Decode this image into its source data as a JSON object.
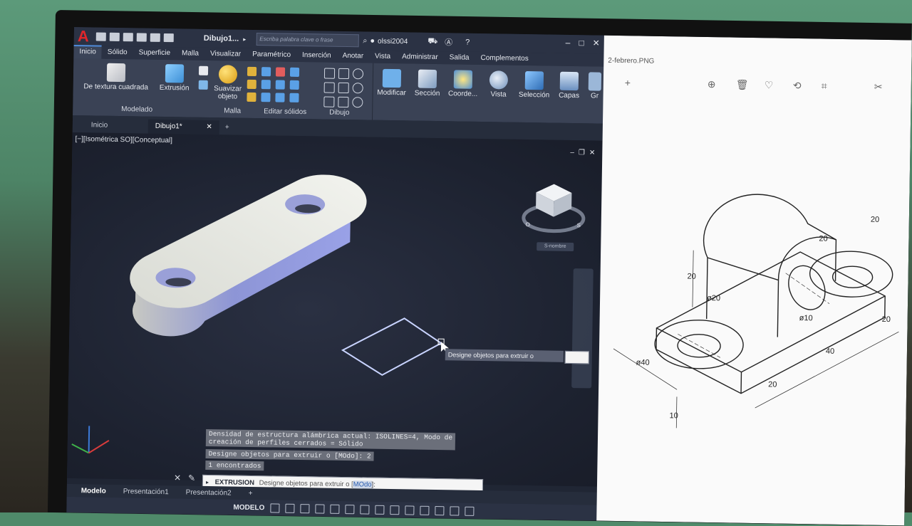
{
  "app": {
    "doc_title": "Dibujo1...",
    "search_placeholder": "Escriba palabra clave o frase",
    "user": "olssi2004"
  },
  "ribbon_tabs": [
    "Inicio",
    "Sólido",
    "Superficie",
    "Malla",
    "Visualizar",
    "Paramétrico",
    "Inserción",
    "Anotar",
    "Vista",
    "Administrar",
    "Salida",
    "Complementos"
  ],
  "ribbon": {
    "textura": "De textura cuadrada",
    "extrusion": "Extrusión",
    "suavizar": "Suavizar\nobjeto",
    "modificar": "Modificar",
    "seccion": "Sección",
    "coorde": "Coorde...",
    "vista": "Vista",
    "seleccion": "Selección",
    "capas": "Capas",
    "gr": "Gr",
    "panel_modelado": "Modelado",
    "panel_malla": "Malla",
    "panel_editar": "Editar sólidos",
    "panel_dibujo": "Dibujo"
  },
  "file_tabs": {
    "start": "Inicio",
    "doc": "Dibujo1*"
  },
  "viewport": {
    "label": "[−][Isométrica SO][Conceptual]",
    "viewcube_label": "S-nombre"
  },
  "tooltip": "Designe objetos para extruir o",
  "command_history": [
    "Densidad de estructura alámbrica actual: ISOLINES=4, Modo de\ncreación de perfiles cerrados = Sólido",
    "Designe objetos para extruir o [MOdo]: 2",
    "1 encontrados"
  ],
  "command_line": {
    "command": "EXTRUSION",
    "prompt": "Designe objetos para extruir o [",
    "option": "MOdo",
    "suffix": "]:"
  },
  "layout_tabs": [
    "Modelo",
    "Presentación1",
    "Presentación2"
  ],
  "status": {
    "model": "MODELO"
  },
  "viewer": {
    "title": "2-febrero.PNG",
    "dims": [
      "20",
      "20",
      "20",
      "ø10",
      "ø20",
      "ø40",
      "40",
      "20",
      "20",
      "10"
    ]
  }
}
